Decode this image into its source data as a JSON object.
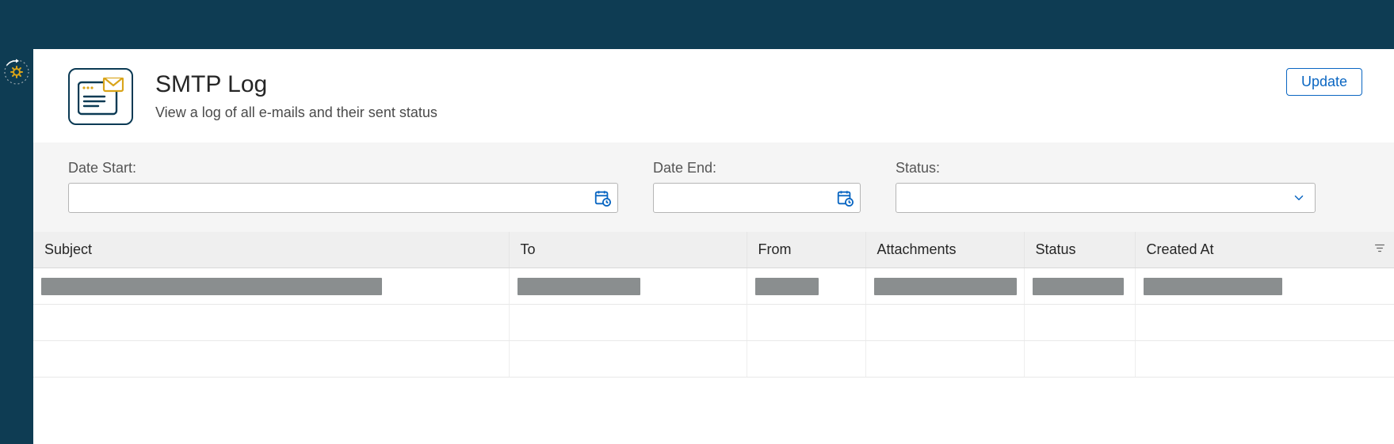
{
  "page": {
    "title": "SMTP Log",
    "subtitle": "View a log of all e-mails and their sent status"
  },
  "actions": {
    "update_label": "Update"
  },
  "filters": {
    "date_start": {
      "label": "Date Start:",
      "value": ""
    },
    "date_end": {
      "label": "Date End:",
      "value": ""
    },
    "status": {
      "label": "Status:",
      "value": ""
    }
  },
  "columns": {
    "subject": "Subject",
    "to": "To",
    "from": "From",
    "attachments": "Attachments",
    "status": "Status",
    "created_at": "Created At"
  },
  "rows": [
    {
      "subject": "",
      "to": "",
      "from": "",
      "attachments": "",
      "status": "",
      "created_at": ""
    }
  ]
}
